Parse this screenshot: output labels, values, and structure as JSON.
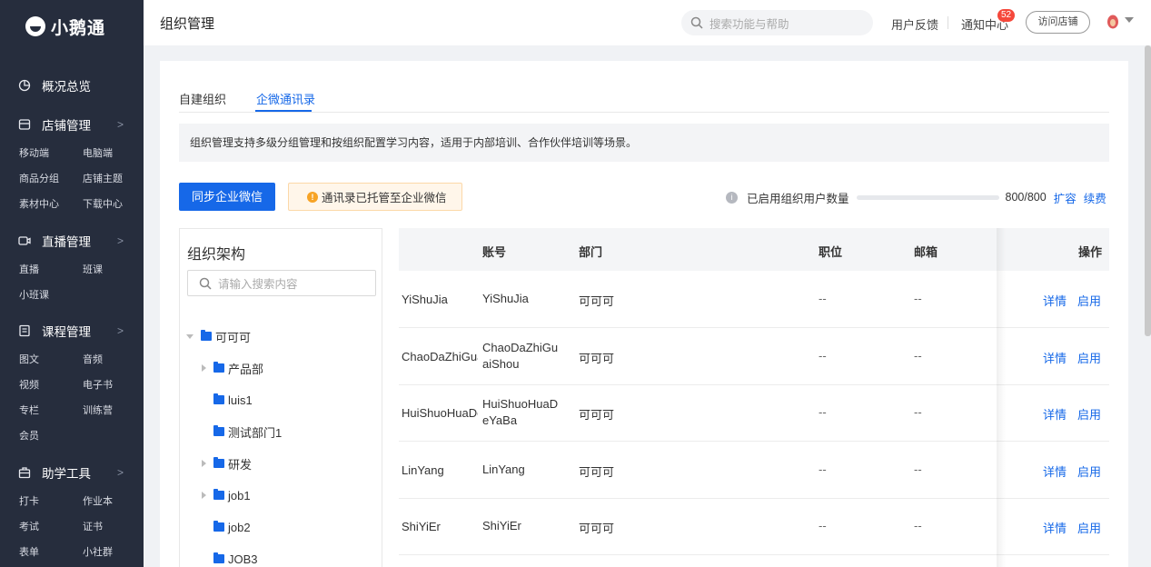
{
  "sidebar": {
    "logo": "小鹅通",
    "sections": [
      {
        "label": "概况总览",
        "icon": "pie-chart-icon",
        "chev": false,
        "items": []
      },
      {
        "label": "店铺管理",
        "icon": "store-icon",
        "chev": true,
        "items": [
          "移动端",
          "电脑端",
          "商品分组",
          "店铺主题",
          "素材中心",
          "下载中心"
        ]
      },
      {
        "label": "直播管理",
        "icon": "video-icon",
        "chev": true,
        "items": [
          "直播",
          "班课",
          "小班课"
        ]
      },
      {
        "label": "课程管理",
        "icon": "course-icon",
        "chev": true,
        "items": [
          "图文",
          "音频",
          "视频",
          "电子书",
          "专栏",
          "训练营",
          "会员"
        ]
      },
      {
        "label": "助学工具",
        "icon": "toolbox-icon",
        "chev": true,
        "items": [
          "打卡",
          "作业本",
          "考试",
          "证书",
          "表单",
          "小社群"
        ]
      }
    ]
  },
  "topbar": {
    "title": "组织管理",
    "search_placeholder": "搜索功能与帮助",
    "feedback": "用户反馈",
    "notifications": "通知中心",
    "notif_count": "52",
    "visit_store": "访问店铺"
  },
  "tabs": [
    "自建组织",
    "企微通讯录"
  ],
  "notice": "组织管理支持多级分组管理和按组织配置学习内容，适用于内部培训、合作伙伴培训等场景。",
  "sync_button": "同步企业微信",
  "hosted_tag": "通讯录已托管至企业微信",
  "usage": {
    "label": "已启用组织用户数量",
    "used": 800,
    "total": 800,
    "text": "800/800",
    "expand": "扩容",
    "renew": "续费"
  },
  "org": {
    "title": "组织架构",
    "search_placeholder": "请输入搜索内容",
    "tree": [
      {
        "label": "可可可",
        "level": 0,
        "toggle": "down"
      },
      {
        "label": "产品部",
        "level": 1,
        "toggle": "right"
      },
      {
        "label": "luis1",
        "level": 1,
        "toggle": "none"
      },
      {
        "label": "测试部门1",
        "level": 1,
        "toggle": "none"
      },
      {
        "label": "研发",
        "level": 1,
        "toggle": "right"
      },
      {
        "label": "job1",
        "level": 1,
        "toggle": "right"
      },
      {
        "label": "job2",
        "level": 1,
        "toggle": "none"
      },
      {
        "label": "JOB3",
        "level": 1,
        "toggle": "none"
      }
    ]
  },
  "table": {
    "headers": {
      "account": "账号",
      "dept": "部门",
      "position": "职位",
      "email": "邮箱",
      "ops": "操作"
    },
    "rows": [
      {
        "name": "YiShuJia",
        "account": "YiShuJia",
        "dept": "可可可",
        "position": "--",
        "email": "--",
        "detail": "详情",
        "enable": "启用"
      },
      {
        "name": "ChaoDaZhiGuaiShou",
        "account": "ChaoDaZhiGuaiShou",
        "dept": "可可可",
        "position": "--",
        "email": "--",
        "detail": "详情",
        "enable": "启用"
      },
      {
        "name": "HuiShuoHuaDeYaBa",
        "account": "HuiShuoHuaDeYaBa",
        "dept": "可可可",
        "position": "--",
        "email": "--",
        "detail": "详情",
        "enable": "启用"
      },
      {
        "name": "LinYang",
        "account": "LinYang",
        "dept": "可可可",
        "position": "--",
        "email": "--",
        "detail": "详情",
        "enable": "启用"
      },
      {
        "name": "ShiYiEr",
        "account": "ShiYiEr",
        "dept": "可可可",
        "position": "--",
        "email": "--",
        "detail": "详情",
        "enable": "启用"
      }
    ]
  }
}
